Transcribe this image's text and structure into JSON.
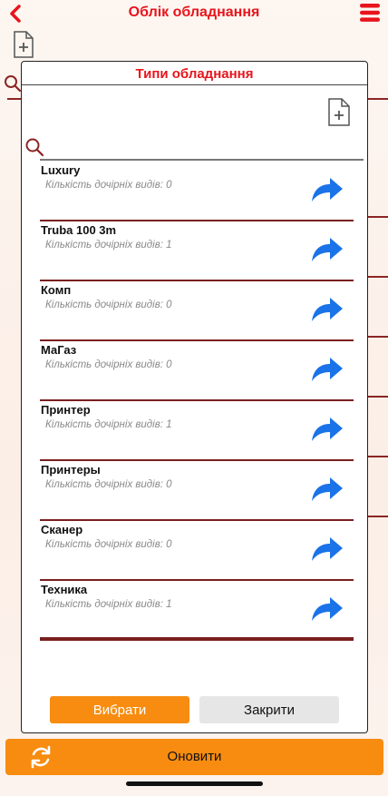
{
  "header": {
    "title": "Облік обладнання"
  },
  "modal": {
    "title": "Типи обладнання",
    "search": {
      "value": "",
      "placeholder": ""
    },
    "items": [
      {
        "name": "Luxury",
        "count": "Кількість дочірніх видів: 0"
      },
      {
        "name": "Truba 100 3m",
        "count": "Кількість дочірніх видів: 1"
      },
      {
        "name": "Комп",
        "count": "Кількість дочірніх видів: 0"
      },
      {
        "name": "МаГаз",
        "count": "Кількість дочірніх видів: 0"
      },
      {
        "name": "Принтер",
        "count": "Кількість дочірніх видів: 1"
      },
      {
        "name": "Принтеры",
        "count": "Кількість дочірніх видів: 0"
      },
      {
        "name": "Сканер",
        "count": "Кількість дочірніх видів: 0"
      },
      {
        "name": "Техника",
        "count": "Кількість дочірніх видів: 1"
      }
    ],
    "select_label": "Вибрати",
    "close_label": "Закрити"
  },
  "footer": {
    "refresh_label": "Оновити"
  },
  "icons": {
    "back": "chevron-left-icon",
    "menu": "hamburger-menu-icon",
    "add_document": "add-document-icon",
    "search": "search-icon",
    "item_action": "share-arrow-icon",
    "refresh": "refresh-icon"
  },
  "colors": {
    "title_red": "#e8141c",
    "accent_orange": "#f78c10",
    "divider_maroon": "#7a1f1f",
    "arrow_blue": "#1a73e8",
    "muted_grey": "#8a8a8a"
  }
}
